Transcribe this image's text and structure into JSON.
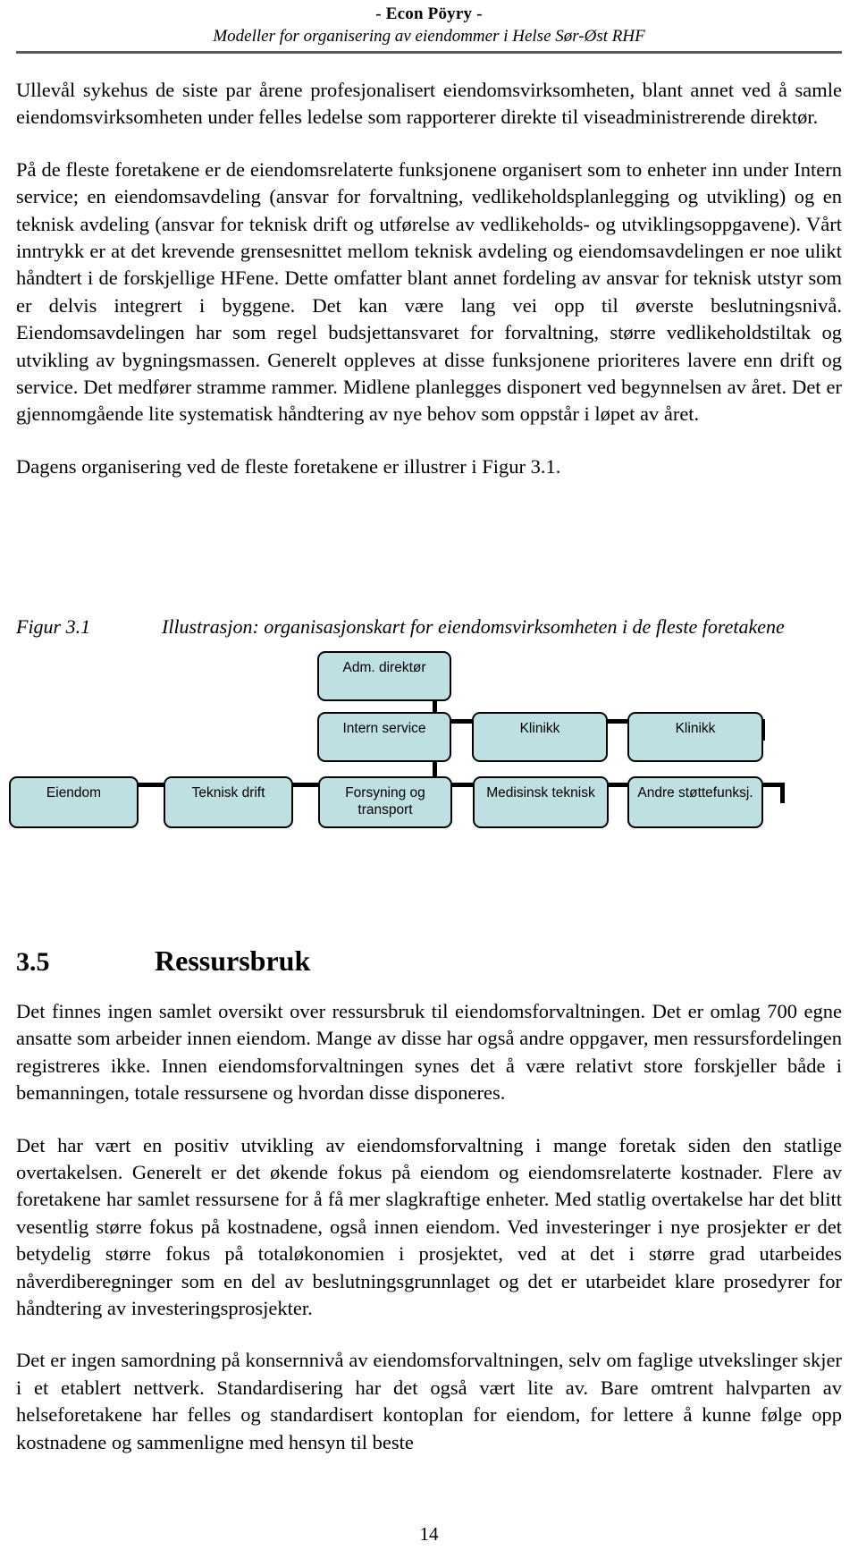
{
  "header": {
    "company": "- Econ Pöyry -",
    "document_title": "Modeller for organisering av eiendommer i Helse Sør-Øst RHF"
  },
  "body": {
    "paragraph_1": "Ullevål sykehus de siste par årene profesjonalisert eiendomsvirksomheten, blant annet ved å samle eiendomsvirksomheten under felles ledelse som rapporterer direkte til viseadministrerende direktør.",
    "paragraph_2": "På de fleste foretakene er de eiendomsrelaterte funksjonene organisert som to enheter inn under Intern service; en eiendomsavdeling (ansvar for forvaltning, vedlikeholdsplanlegging og utvikling) og en teknisk avdeling (ansvar for teknisk drift og utførelse av vedlikeholds- og utviklingsoppgavene). Vårt inntrykk er at det krevende grensesnittet mellom teknisk avdeling og eiendomsavdelingen er noe ulikt håndtert i de forskjellige HFene. Dette omfatter blant annet fordeling av ansvar for teknisk utstyr som er delvis integrert i byggene. Det kan være lang vei opp til øverste beslutningsnivå. Eiendomsavdelingen har som regel budsjettansvaret for forvaltning, større vedlikeholdstiltak og utvikling av bygningsmassen. Generelt oppleves at disse funksjonene prioriteres lavere enn drift og service. Det medfører stramme rammer. Midlene planlegges disponert ved begynnelsen av året. Det er gjennomgående lite systematisk håndtering av nye behov som oppstår i løpet av året.",
    "paragraph_3": "Dagens organisering ved de fleste foretakene er illustrer i Figur 3.1."
  },
  "figure": {
    "label": "Figur 3.1",
    "caption": "Illustrasjon: organisasjonskart for eiendomsvirksomheten i de fleste foretakene",
    "fill_color": "#bfe0e3",
    "border_color": "#000000"
  },
  "chart_data": {
    "type": "diagram",
    "title": "Illustrasjon: organisasjonskart for eiendomsvirksomheten i de fleste foretakene",
    "nodes": [
      {
        "id": "adm",
        "label": "Adm. direktør",
        "level": 0
      },
      {
        "id": "intern",
        "label": "Intern service",
        "level": 1
      },
      {
        "id": "klinikk1",
        "label": "Klinikk",
        "level": 1
      },
      {
        "id": "klinikk2",
        "label": "Klinikk",
        "level": 1
      },
      {
        "id": "eiendom",
        "label": "Eiendom",
        "level": 2
      },
      {
        "id": "teknisk",
        "label": "Teknisk drift",
        "level": 2
      },
      {
        "id": "forsyning",
        "label": "Forsyning og transport",
        "level": 2
      },
      {
        "id": "medisinsk",
        "label": "Medisinsk teknisk",
        "level": 2
      },
      {
        "id": "andre",
        "label": "Andre støttefunksj.",
        "level": 2
      }
    ],
    "edges": [
      {
        "from": "adm",
        "to": "intern"
      },
      {
        "from": "adm",
        "to": "klinikk1"
      },
      {
        "from": "adm",
        "to": "klinikk2"
      },
      {
        "from": "intern",
        "to": "eiendom"
      },
      {
        "from": "intern",
        "to": "teknisk"
      },
      {
        "from": "intern",
        "to": "forsyning"
      },
      {
        "from": "intern",
        "to": "medisinsk"
      },
      {
        "from": "intern",
        "to": "andre"
      }
    ]
  },
  "section": {
    "number": "3.5",
    "title": "Ressursbruk",
    "paragraph_1": "Det finnes ingen samlet oversikt over ressursbruk til eiendomsforvaltningen. Det er omlag 700 egne ansatte som arbeider innen eiendom. Mange av disse har også andre oppgaver, men ressursfordelingen registreres ikke. Innen eiendomsforvaltningen synes det å være relativt store forskjeller både i bemanningen, totale ressursene og hvordan disse disponeres.",
    "paragraph_2": "Det har vært en positiv utvikling av eiendomsforvaltning i mange foretak siden den statlige overtakelsen. Generelt er det økende fokus på eiendom og eiendomsrelaterte kostnader. Flere av foretakene har samlet ressursene for å få mer slagkraftige enheter. Med statlig overtakelse har det blitt vesentlig større fokus på kostnadene, også innen eiendom. Ved investeringer i nye prosjekter er det betydelig større fokus på totaløkonomien i prosjektet, ved at det i større grad utarbeides nåverdiberegninger som en del av beslutningsgrunnlaget og det er utarbeidet klare prosedyrer for håndtering av investeringsprosjekter.",
    "paragraph_3": "Det er ingen samordning på konsernnivå av eiendomsforvaltningen, selv om faglige utvekslinger skjer i et etablert nettverk. Standardisering har det også vært lite av. Bare omtrent halvparten av helseforetakene har felles og standardisert kontoplan for eiendom, for lettere å kunne følge opp kostnadene og sammenligne med hensyn til beste"
  },
  "footer": {
    "page_number": "14"
  }
}
